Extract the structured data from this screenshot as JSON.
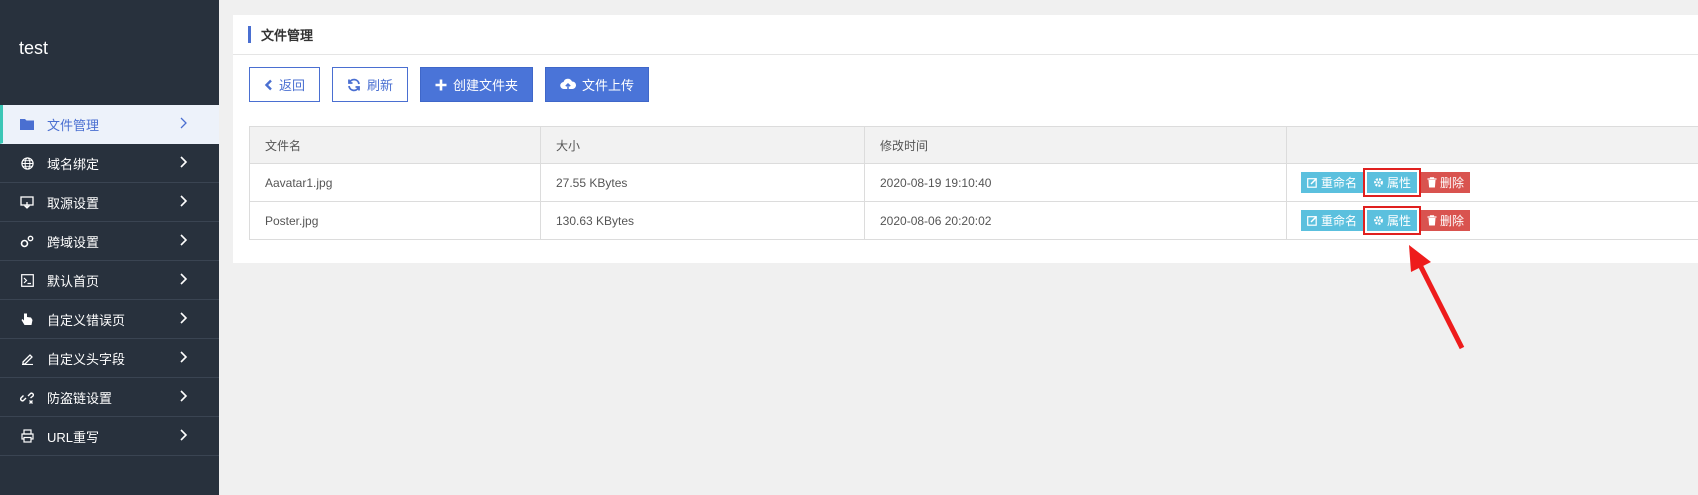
{
  "brand": "test",
  "sidebar": {
    "items": [
      {
        "label": "文件管理",
        "icon": "folder-icon",
        "active": true
      },
      {
        "label": "域名绑定",
        "icon": "globe-icon"
      },
      {
        "label": "取源设置",
        "icon": "download-window-icon"
      },
      {
        "label": "跨域设置",
        "icon": "gears-icon"
      },
      {
        "label": "默认首页",
        "icon": "terminal-icon"
      },
      {
        "label": "自定义错误页",
        "icon": "hand-pointer-icon"
      },
      {
        "label": "自定义头字段",
        "icon": "pencil-icon"
      },
      {
        "label": "防盗链设置",
        "icon": "unlink-icon"
      },
      {
        "label": "URL重写",
        "icon": "print-icon"
      }
    ]
  },
  "panel": {
    "title": "文件管理"
  },
  "toolbar": {
    "back": "返回",
    "refresh": "刷新",
    "create_folder": "创建文件夹",
    "upload": "文件上传"
  },
  "table": {
    "headers": [
      "文件名",
      "大小",
      "修改时间",
      ""
    ],
    "rows": [
      {
        "name": "Aavatar1.jpg",
        "size": "27.55 KBytes",
        "modified": "2020-08-19 19:10:40"
      },
      {
        "name": "Poster.jpg",
        "size": "130.63 KBytes",
        "modified": "2020-08-06 20:20:02"
      }
    ],
    "actions": {
      "rename": "重命名",
      "properties": "属性",
      "delete": "删除"
    }
  },
  "colors": {
    "accent": "#4a74d8",
    "sidebar_bg": "#28313d",
    "info": "#5bc0de",
    "danger": "#d9534f",
    "highlight": "#e0201f"
  }
}
